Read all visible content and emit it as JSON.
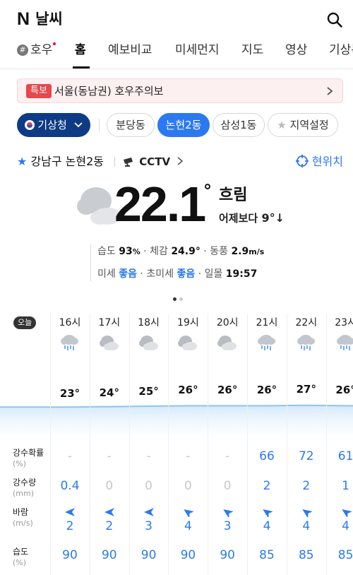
{
  "header": {
    "logo": "N",
    "title": "날씨"
  },
  "tabs": [
    {
      "label": "호우",
      "hashtag": "#"
    },
    {
      "label": "홈"
    },
    {
      "label": "예보비교"
    },
    {
      "label": "미세먼지"
    },
    {
      "label": "지도"
    },
    {
      "label": "영상"
    },
    {
      "label": "기상특보"
    }
  ],
  "alert": {
    "badge": "특보",
    "text": "서울(동남권) 호우주의보"
  },
  "sources": {
    "provider": "기상청",
    "locations": [
      "분당동",
      "논현2동",
      "삼성1동"
    ],
    "setting": "지역설정"
  },
  "location": {
    "name": "강남구 논현2동",
    "cctv": "CCTV",
    "current_location": "현위치"
  },
  "current": {
    "temp": "22.1",
    "degree": "°",
    "condition": "흐림",
    "compare_prefix": "어제보다",
    "compare_value": "9°↓",
    "humidity_label": "습도",
    "humidity": "93",
    "humidity_unit": "%",
    "feels_label": "체감",
    "feels": "24.9°",
    "wind_label": "동풍",
    "wind": "2.9",
    "wind_unit": "m/s",
    "dust_label": "미세",
    "dust": "좋음",
    "fine_dust_label": "초미세",
    "fine_dust": "좋음",
    "sunset_label": "일몰",
    "sunset": "19:57"
  },
  "hourly": {
    "today_label": "오늘",
    "hours": [
      {
        "hour": "16시",
        "icon": "rain-icon",
        "temp": "23°",
        "precip_prob": "-",
        "precip": "0.4",
        "wind_dir": "W",
        "wind": "2",
        "humidity": "90"
      },
      {
        "hour": "17시",
        "icon": "cloudy-icon",
        "temp": "24°",
        "precip_prob": "-",
        "precip": "0",
        "wind_dir": "W",
        "wind": "2",
        "humidity": "90"
      },
      {
        "hour": "18시",
        "icon": "cloudy-icon",
        "temp": "25°",
        "precip_prob": "-",
        "precip": "0",
        "wind_dir": "W",
        "wind": "3",
        "humidity": "90"
      },
      {
        "hour": "19시",
        "icon": "cloudy-icon",
        "temp": "26°",
        "precip_prob": "-",
        "precip": "0",
        "wind_dir": "NW",
        "wind": "4",
        "humidity": "90"
      },
      {
        "hour": "20시",
        "icon": "cloudy-icon",
        "temp": "26°",
        "precip_prob": "-",
        "precip": "0",
        "wind_dir": "NW",
        "wind": "3",
        "humidity": "90"
      },
      {
        "hour": "21시",
        "icon": "rain-icon",
        "temp": "26°",
        "precip_prob": "66",
        "precip": "2",
        "wind_dir": "NW",
        "wind": "4",
        "humidity": "85"
      },
      {
        "hour": "22시",
        "icon": "rain-icon",
        "temp": "27°",
        "precip_prob": "72",
        "precip": "2",
        "wind_dir": "NW",
        "wind": "4",
        "humidity": "85"
      },
      {
        "hour": "23시",
        "icon": "rain-icon",
        "temp": "26°",
        "precip_prob": "61",
        "precip": "1",
        "wind_dir": "NW",
        "wind": "4",
        "humidity": "85"
      }
    ],
    "row_labels": {
      "precip_prob": "강수확률",
      "precip_prob_unit": "(%)",
      "precip": "강수량",
      "precip_unit": "(mm)",
      "wind": "바람",
      "wind_unit": "(m/s)",
      "humidity": "습도",
      "humidity_unit": "(%)"
    }
  },
  "colors": {
    "accent": "#2b79f0",
    "provider_chip": "#0d3b86",
    "alert_badge": "#e5484d"
  }
}
